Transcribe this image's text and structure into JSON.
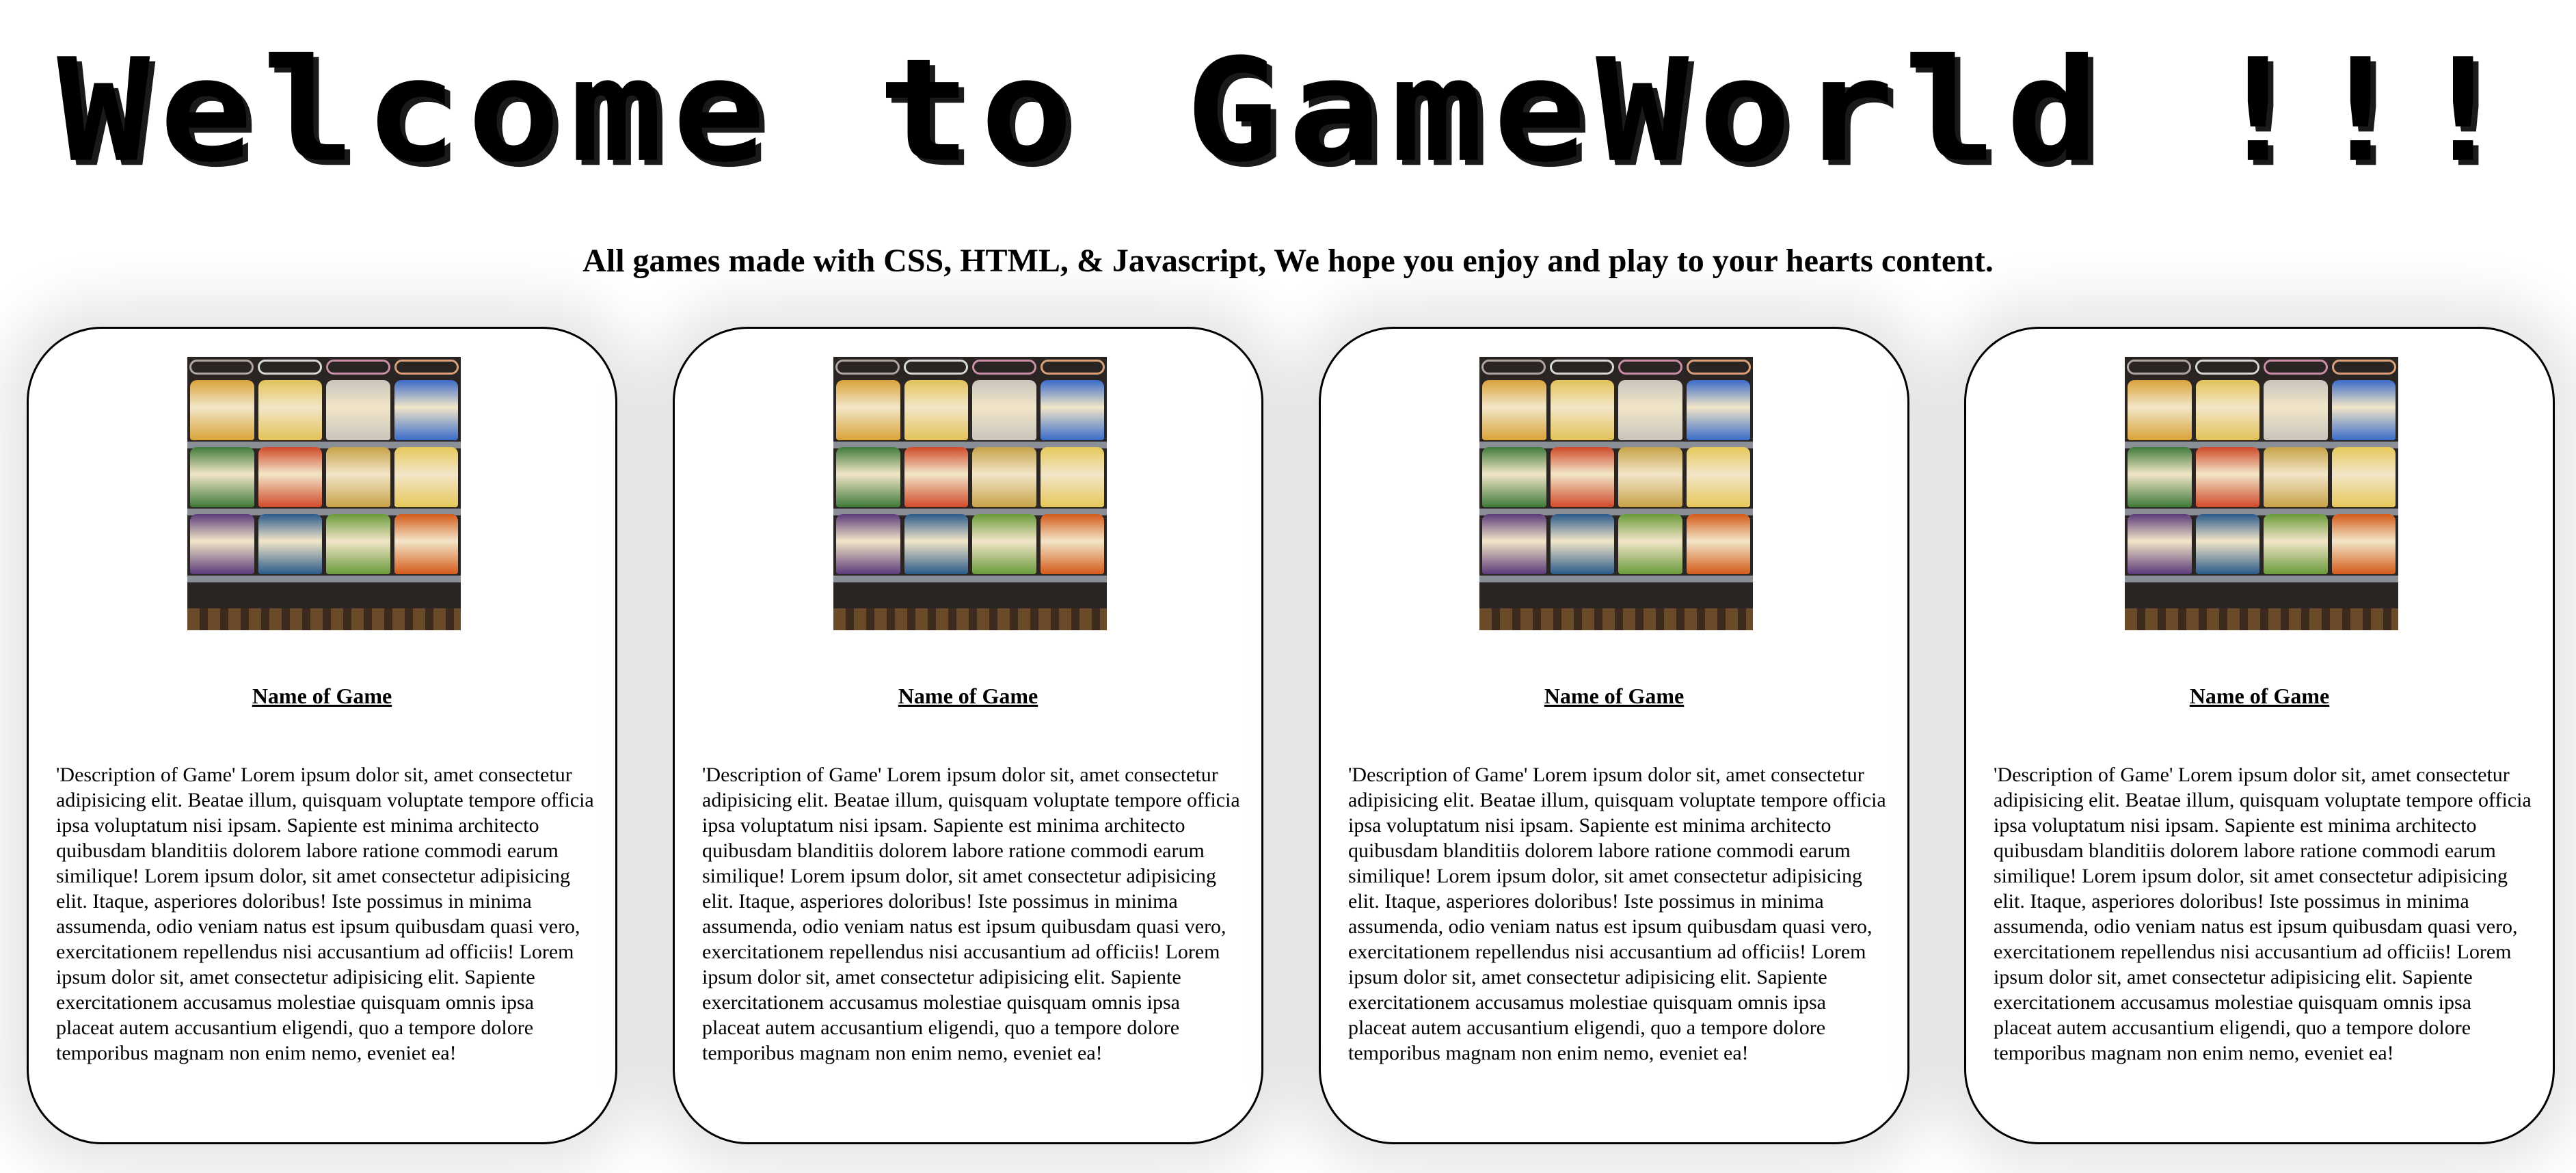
{
  "header": {
    "title": "Welcome to GameWorld !!!",
    "subtitle": "All games made with CSS, HTML, & Javascript, We hope you enjoy and play to your hearts content."
  },
  "cards": [
    {
      "name": "Name of Game",
      "description": "'Description of Game' Lorem ipsum dolor sit, amet consectetur adipisicing elit. Beatae illum, quisquam voluptate tempore officia ipsa voluptatum nisi ipsam. Sapiente est minima architecto quibusdam blanditiis dolorem labore ratione commodi earum similique! Lorem ipsum dolor, sit amet consectetur adipisicing elit. Itaque, asperiores doloribus! Iste possimus in minima assumenda, odio veniam natus est ipsum quibusdam quasi vero, exercitationem repellendus nisi accusantium ad officiis! Lorem ipsum dolor sit, amet consectetur adipisicing elit. Sapiente exercitationem accusamus molestiae quisquam omnis ipsa placeat autem accusantium eligendi, quo a tempore dolore temporibus magnam non enim nemo, eveniet ea!",
      "image_icon": "vending-machine-snacks-image"
    },
    {
      "name": "Name of Game",
      "description": "'Description of Game' Lorem ipsum dolor sit, amet consectetur adipisicing elit. Beatae illum, quisquam voluptate tempore officia ipsa voluptatum nisi ipsam. Sapiente est minima architecto quibusdam blanditiis dolorem labore ratione commodi earum similique! Lorem ipsum dolor, sit amet consectetur adipisicing elit. Itaque, asperiores doloribus! Iste possimus in minima assumenda, odio veniam natus est ipsum quibusdam quasi vero, exercitationem repellendus nisi accusantium ad officiis! Lorem ipsum dolor sit, amet consectetur adipisicing elit. Sapiente exercitationem accusamus molestiae quisquam omnis ipsa placeat autem accusantium eligendi, quo a tempore dolore temporibus magnam non enim nemo, eveniet ea!",
      "image_icon": "vending-machine-snacks-image"
    },
    {
      "name": "Name of Game",
      "description": "'Description of Game' Lorem ipsum dolor sit, amet consectetur adipisicing elit. Beatae illum, quisquam voluptate tempore officia ipsa voluptatum nisi ipsam. Sapiente est minima architecto quibusdam blanditiis dolorem labore ratione commodi earum similique! Lorem ipsum dolor, sit amet consectetur adipisicing elit. Itaque, asperiores doloribus! Iste possimus in minima assumenda, odio veniam natus est ipsum quibusdam quasi vero, exercitationem repellendus nisi accusantium ad officiis! Lorem ipsum dolor sit, amet consectetur adipisicing elit. Sapiente exercitationem accusamus molestiae quisquam omnis ipsa placeat autem accusantium eligendi, quo a tempore dolore temporibus magnam non enim nemo, eveniet ea!",
      "image_icon": "vending-machine-snacks-image"
    },
    {
      "name": "Name of Game",
      "description": "'Description of Game' Lorem ipsum dolor sit, amet consectetur adipisicing elit. Beatae illum, quisquam voluptate tempore officia ipsa voluptatum nisi ipsam. Sapiente est minima architecto quibusdam blanditiis dolorem labore ratione commodi earum similique! Lorem ipsum dolor, sit amet consectetur adipisicing elit. Itaque, asperiores doloribus! Iste possimus in minima assumenda, odio veniam natus est ipsum quibusdam quasi vero, exercitationem repellendus nisi accusantium ad officiis! Lorem ipsum dolor sit, amet consectetur adipisicing elit. Sapiente exercitationem accusamus molestiae quisquam omnis ipsa placeat autem accusantium eligendi, quo a tempore dolore temporibus magnam non enim nemo, eveniet ea!",
      "image_icon": "vending-machine-snacks-image"
    }
  ]
}
